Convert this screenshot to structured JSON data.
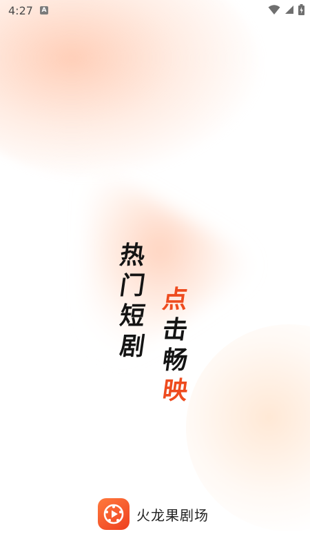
{
  "status_bar": {
    "time": "4:27",
    "notification_icon": "A",
    "icons": [
      "wifi-icon",
      "cellular-signal-icon",
      "battery-icon"
    ]
  },
  "slogan": {
    "left_column": [
      "热",
      "门",
      "短",
      "剧"
    ],
    "right_column": [
      "点",
      "击",
      "畅",
      "映"
    ],
    "colors": {
      "dark": "#141414",
      "accent": "#ee4b1e"
    }
  },
  "brand": {
    "logo_icon": "play-film-reel-icon",
    "name": "火龙果剧场",
    "logo_color": "#ee4b1e"
  }
}
